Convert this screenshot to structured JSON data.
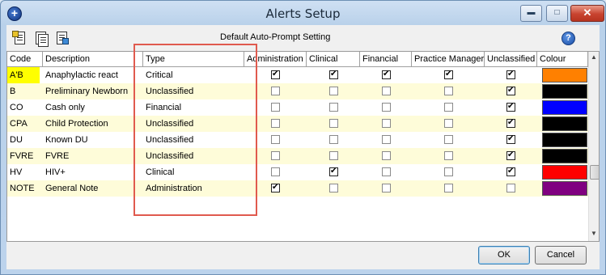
{
  "window": {
    "title": "Alerts Setup",
    "min_glyph": "▬",
    "max_glyph": "□",
    "close_glyph": "✕",
    "app_icon_glyph": "+"
  },
  "toolbar": {
    "buttons": [
      {
        "icon": "new-alert-icon"
      },
      {
        "icon": "copy-alert-icon"
      },
      {
        "icon": "alert-properties-icon"
      }
    ],
    "label": "Default Auto-Prompt Setting",
    "help_glyph": "?"
  },
  "table": {
    "columns": [
      "Code",
      "Description",
      "Type",
      "Administration",
      "Clinical",
      "Financial",
      "Practice Manager",
      "Unclassified",
      "Colour"
    ],
    "rows": [
      {
        "code": "A'B",
        "description": "Anaphylactic react",
        "type": "Critical",
        "admin": true,
        "clinical": true,
        "financial": true,
        "pm": true,
        "unclassified": true,
        "colour": "#ff8000"
      },
      {
        "code": "B",
        "description": "Preliminary Newborn",
        "type": "Unclassified",
        "admin": false,
        "clinical": false,
        "financial": false,
        "pm": false,
        "unclassified": true,
        "colour": "#000000"
      },
      {
        "code": "CO",
        "description": "Cash only",
        "type": "Financial",
        "admin": false,
        "clinical": false,
        "financial": false,
        "pm": false,
        "unclassified": true,
        "colour": "#0000ff"
      },
      {
        "code": "CPA",
        "description": "Child Protection",
        "type": "Unclassified",
        "admin": false,
        "clinical": false,
        "financial": false,
        "pm": false,
        "unclassified": true,
        "colour": "#000000"
      },
      {
        "code": "DU",
        "description": "Known DU",
        "type": "Unclassified",
        "admin": false,
        "clinical": false,
        "financial": false,
        "pm": false,
        "unclassified": true,
        "colour": "#000000"
      },
      {
        "code": "FVRE",
        "description": "FVRE",
        "type": "Unclassified",
        "admin": false,
        "clinical": false,
        "financial": false,
        "pm": false,
        "unclassified": true,
        "colour": "#000000"
      },
      {
        "code": "HV",
        "description": "HIV+",
        "type": "Clinical",
        "admin": false,
        "clinical": true,
        "financial": false,
        "pm": false,
        "unclassified": true,
        "colour": "#ff0000"
      },
      {
        "code": "NOTE",
        "description": "General Note",
        "type": "Administration",
        "admin": true,
        "clinical": false,
        "financial": false,
        "pm": false,
        "unclassified": false,
        "colour": "#800080"
      }
    ]
  },
  "scroll": {
    "up_glyph": "▲",
    "down_glyph": "▼"
  },
  "buttons": {
    "ok": "OK",
    "cancel": "Cancel"
  },
  "colors": {
    "highlight_border": "#e05a4e",
    "alt_row": "#fefcd9",
    "selected_code": "#ffff00"
  }
}
